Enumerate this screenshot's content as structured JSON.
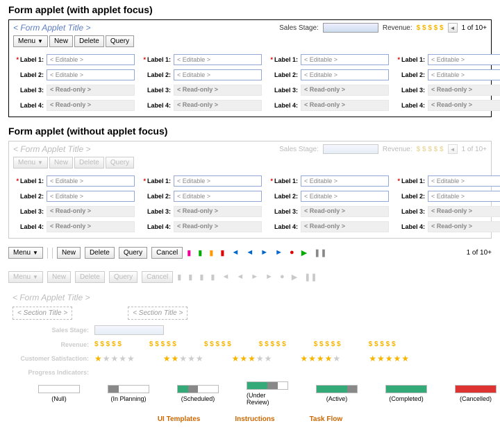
{
  "headings": {
    "with_focus": "Form applet (with applet focus)",
    "without_focus": "Form applet (without applet focus)"
  },
  "applet": {
    "title": "< Form Applet Title >",
    "sales_stage_label": "Sales Stage:",
    "revenue_label": "Revenue:",
    "revenue_value": "$ $ $ $ $",
    "counter": "1 of 10+",
    "buttons": {
      "menu": "Menu",
      "new": "New",
      "delete": "Delete",
      "query": "Query",
      "cancel": "Cancel"
    },
    "labels": {
      "l1": "Label 1:",
      "l2": "Label 2:",
      "l3": "Label 3:",
      "l4": "Label 4:"
    },
    "placeholders": {
      "editable": "< Editable >",
      "readonly": "< Read-only >"
    }
  },
  "section": {
    "title": "< Section Title >",
    "sales_stage": "Sales Stage:",
    "revenue": "Revenue:",
    "cust_sat": "Customer Satisfaction:",
    "prog_ind": "Progress Indicators:"
  },
  "progress": {
    "null": "(Null)",
    "planning": "(In Planning)",
    "scheduled": "(Scheduled)",
    "review": "(Under Review)",
    "active": "(Active)",
    "completed": "(Completed)",
    "cancelled": "(Cancelled)"
  },
  "footer": {
    "ui": "UI Templates",
    "inst": "Instructions",
    "task": "Task Flow"
  }
}
